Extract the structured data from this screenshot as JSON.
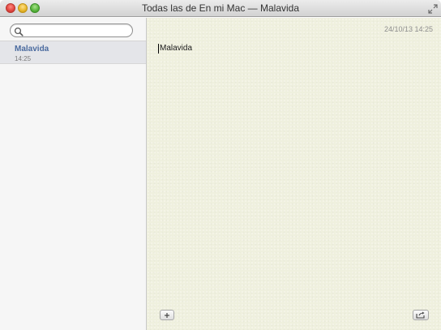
{
  "window": {
    "title": "Todas las de En mi Mac — Malavida"
  },
  "sidebar": {
    "search": {
      "placeholder": "",
      "value": ""
    },
    "notes": [
      {
        "title": "Malavida",
        "time": "14:25",
        "selected": true
      }
    ]
  },
  "note": {
    "date": "24/10/13 14:25",
    "body": "Malavida"
  },
  "toolbar": {
    "add_icon": "plus-icon",
    "share_icon": "share-icon"
  },
  "colors": {
    "note_background": "#eff0de",
    "selected_note_title": "#4b6b9f",
    "sidebar_background": "#f6f6f6"
  }
}
